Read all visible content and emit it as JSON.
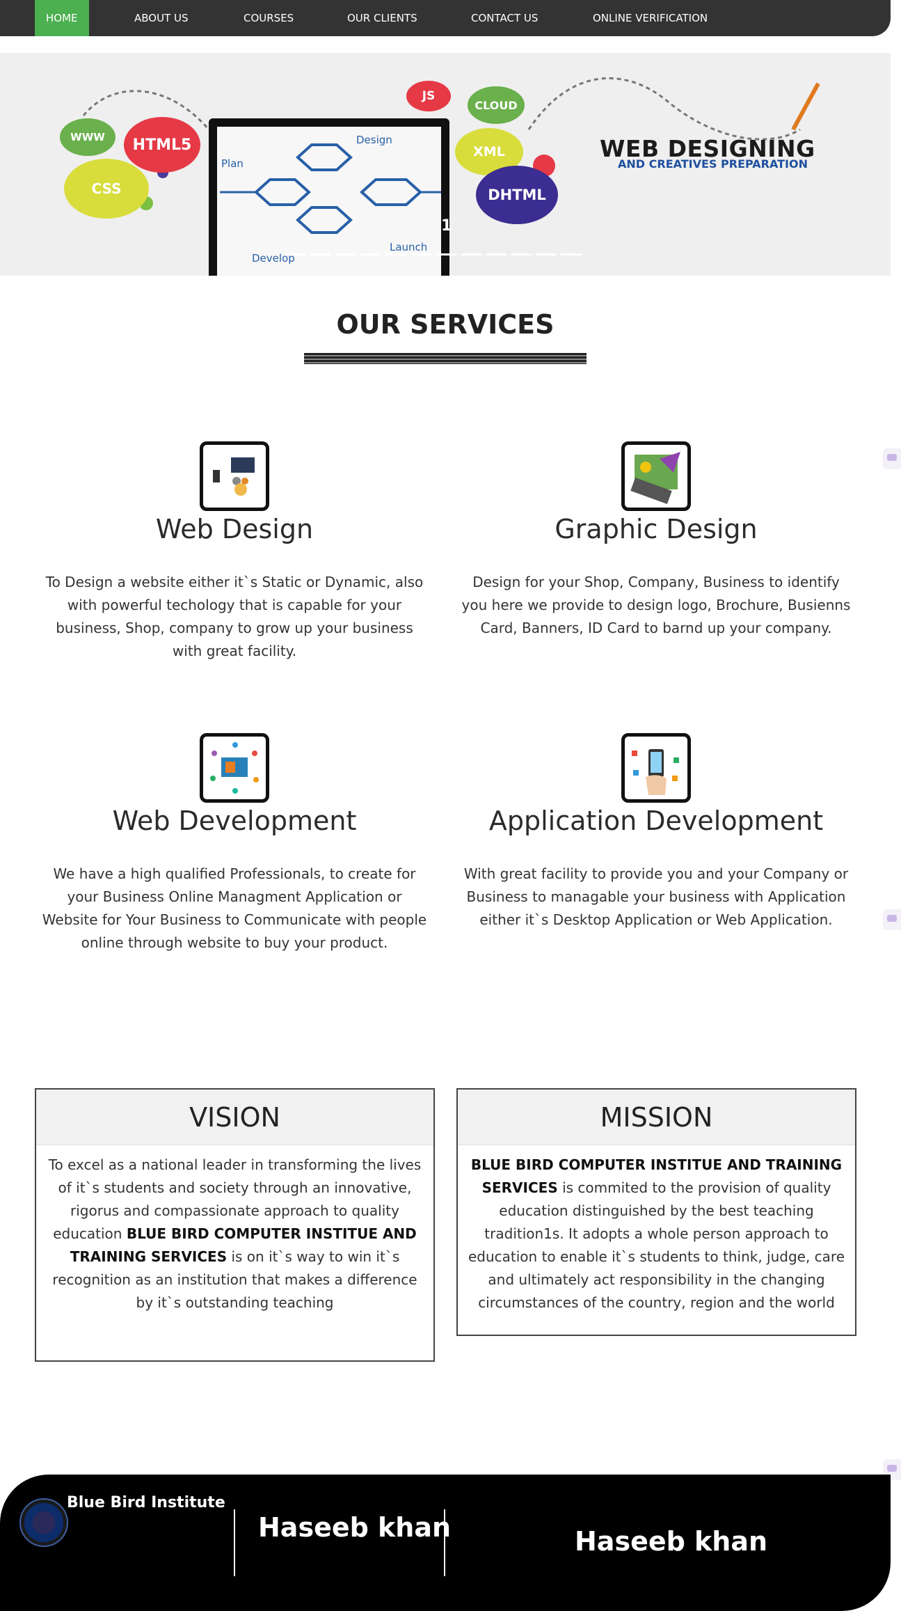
{
  "nav": {
    "items": [
      "HOME",
      "ABOUT US",
      "COURSES",
      "OUR CLIENTS",
      "CONTACT US",
      "ONLINE VERIFICATION"
    ],
    "active": "HOME",
    "accent_color": "#4caf50",
    "bar_color": "#333333"
  },
  "hero": {
    "bubbles": [
      "JS",
      "CLOUD",
      "WWW",
      "HTML5",
      "CSS",
      "XML",
      "DHTML"
    ],
    "diagram_labels": [
      "Plan",
      "Design",
      "Develop",
      "Launch"
    ],
    "title": "WEB DESIGNING",
    "subtitle": "AND CREATIVES PREPARATION",
    "slide_number": "1"
  },
  "services": {
    "heading": "OUR SERVICES",
    "cards": [
      {
        "title": "Web Design",
        "icon": "web-design-icon",
        "text": "To Design a website either it`s Static or Dynamic, also with powerful techology that is capable for your business, Shop, company to grow up your business with great facility."
      },
      {
        "title": "Graphic Design",
        "icon": "graphic-design-icon",
        "text": "Design for your Shop, Company, Business to identify you here we provide to design logo, Brochure, Busienns Card, Banners, ID Card to barnd up your company."
      },
      {
        "title": "Web Development",
        "icon": "web-development-icon",
        "text": "We have a high qualified Professionals, to create for your Business Online Managment Application or Website for Your Business to Communicate with people online through website to buy your product."
      },
      {
        "title": "Application Development",
        "icon": "app-development-icon",
        "text": "With great facility to provide you and your Company or Business to managable your business with Application either it`s Desktop Application or Web Application."
      }
    ]
  },
  "vision": {
    "heading": "VISION",
    "text_before": "To excel as a national leader in transforming the lives of it`s students and society through an innovative, rigorus and compassionate approach to quality education ",
    "institute": "BLUE BIRD COMPUTER INSTITUE AND TRAINING SERVICES",
    "text_after": " is on it`s way to win it`s recognition as an institution that makes a difference by it`s outstanding teaching"
  },
  "mission": {
    "heading": "MISSION",
    "institute": "BLUE BIRD COMPUTER INSTITUE AND TRAINING SERVICES",
    "text_after": " is commited to the provision of quality education distinguished by the best teaching tradition1s. It adopts a whole person approach to education to enable it`s students to think, judge, care and ultimately act responsibility in the changing circumstances of the country, region and the world"
  },
  "footer": {
    "brand": "Blue Bird Institute",
    "name_1": "Haseeb khan",
    "name_2": "Haseeb khan"
  }
}
